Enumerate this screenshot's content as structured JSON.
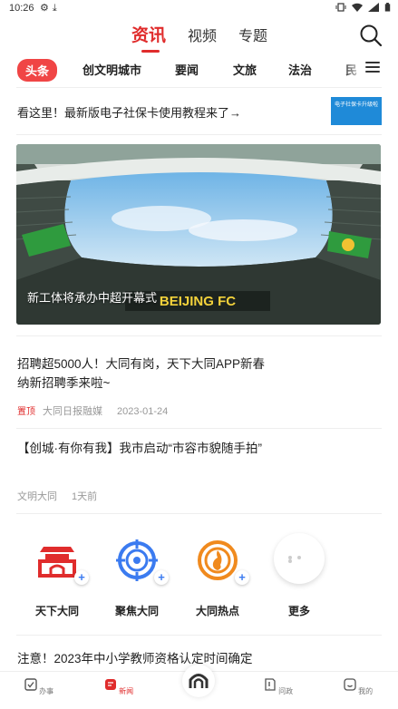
{
  "status_bar": {
    "time": "10:26"
  },
  "top_tabs": [
    {
      "label": "资讯",
      "active": true
    },
    {
      "label": "视频",
      "active": false
    },
    {
      "label": "专题",
      "active": false
    }
  ],
  "categories": [
    {
      "label": "头条",
      "active": true
    },
    {
      "label": "创文明城市"
    },
    {
      "label": "要闻"
    },
    {
      "label": "文旅"
    },
    {
      "label": "法治"
    },
    {
      "label": "民"
    }
  ],
  "banner": {
    "text": "看这里！最新版电子社保卡使用教程来了→",
    "thumb_text": "电子社保卡升级啦"
  },
  "hero": {
    "caption": "新工体将承办中超开幕式",
    "scoreboard_text": "BEIJING FC"
  },
  "articles": [
    {
      "title": "招聘超5000人！大同有岗，天下大同APP新春纳新招聘季来啦~",
      "pin": "置顶",
      "source": "大同日报融媒",
      "date": "2023-01-24"
    },
    {
      "title": "【创城·有你有我】我市启动“市容市貌随手拍”",
      "source": "文明大同",
      "date": "1天前"
    },
    {
      "title": "注意！2023年中小学教师资格认定时间确定"
    }
  ],
  "quick_links": [
    {
      "label": "天下大同",
      "icon": "gate-tower-icon",
      "color": "#e02c2c"
    },
    {
      "label": "聚焦大同",
      "icon": "target-icon",
      "color": "#3b7bf0"
    },
    {
      "label": "大同热点",
      "icon": "flame-ring-icon",
      "color": "#f08a1e"
    },
    {
      "label": "更多",
      "icon": "more-dots-icon"
    }
  ],
  "bottom_nav": [
    {
      "label": "办事",
      "icon": "check-box-icon"
    },
    {
      "label": "新闻",
      "icon": "news-icon",
      "active": true
    },
    {
      "label": "",
      "icon": "home-arch-icon"
    },
    {
      "label": "问政",
      "icon": "question-doc-icon"
    },
    {
      "label": "我的",
      "icon": "smile-icon"
    }
  ],
  "colors": {
    "accent": "#e02c2c",
    "blue": "#3b7bf0",
    "orange": "#f08a1e"
  }
}
